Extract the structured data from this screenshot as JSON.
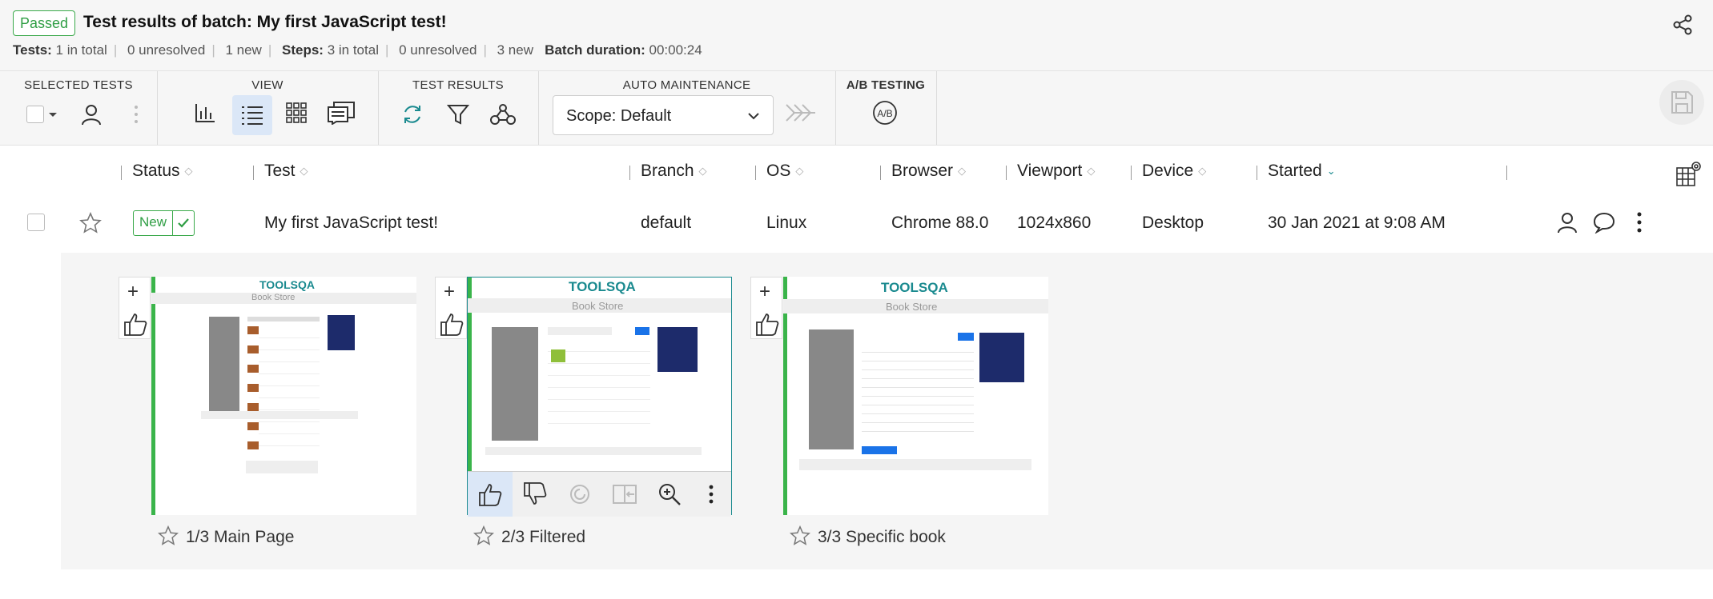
{
  "header": {
    "status_badge": "Passed",
    "title": "Test results of batch: My first JavaScript test!",
    "stats": {
      "tests_label": "Tests:",
      "tests_total": "1 in total",
      "tests_unresolved": "0 unresolved",
      "tests_new": "1 new",
      "steps_label": "Steps:",
      "steps_total": "3 in total",
      "steps_unresolved": "0 unresolved",
      "steps_new": "3 new",
      "duration_label": "Batch duration:",
      "duration_value": "00:00:24"
    }
  },
  "toolbar": {
    "selected_tests": "SELECTED TESTS",
    "view": "VIEW",
    "test_results": "TEST RESULTS",
    "auto_maintenance": "AUTO MAINTENANCE",
    "ab_testing": "A/B TESTING",
    "scope_value": "Scope: Default",
    "ab_icon_text": "A/B"
  },
  "columns": {
    "status": "Status",
    "test": "Test",
    "branch": "Branch",
    "os": "OS",
    "browser": "Browser",
    "viewport": "Viewport",
    "device": "Device",
    "started": "Started"
  },
  "row": {
    "status": "New",
    "test": "My first JavaScript test!",
    "branch": "default",
    "os": "Linux",
    "browser": "Chrome 88.0",
    "viewport": "1024x860",
    "device": "Desktop",
    "started": "30 Jan 2021 at 9:08 AM"
  },
  "steps": [
    {
      "caption": "1/3 Main Page",
      "logo": "TOOLSQA",
      "page_title": "Book Store"
    },
    {
      "caption": "2/3 Filtered",
      "logo": "TOOLSQA",
      "page_title": "Book Store"
    },
    {
      "caption": "3/3 Specific book",
      "logo": "TOOLSQA",
      "page_title": "Book Store"
    }
  ],
  "colors": {
    "accent_green": "#3ab44a",
    "accent_blue": "#1a73e8",
    "teal": "#1a8a8f"
  }
}
